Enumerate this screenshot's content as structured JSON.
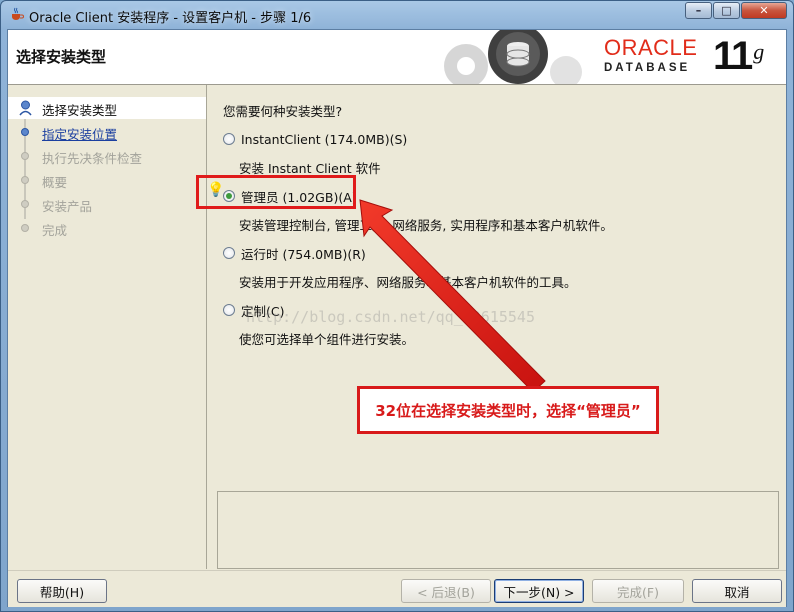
{
  "window": {
    "title": "Oracle Client 安装程序 - 设置客户机 - 步骤 1/6",
    "controls": {
      "minimize": "–",
      "maximize": "□",
      "close": "✕"
    }
  },
  "header": {
    "title": "选择安装类型",
    "brand_name": "ORACLE",
    "brand_sub": "DATABASE",
    "version": "11",
    "version_suffix": "g"
  },
  "steps": [
    {
      "label": "选择安装类型",
      "state": "active"
    },
    {
      "label": "指定安装位置",
      "state": "link"
    },
    {
      "label": "执行先决条件检查",
      "state": "disabled"
    },
    {
      "label": "概要",
      "state": "disabled"
    },
    {
      "label": "安装产品",
      "state": "disabled"
    },
    {
      "label": "完成",
      "state": "disabled"
    }
  ],
  "main": {
    "question": "您需要何种安装类型?",
    "options": [
      {
        "label": "InstantClient (174.0MB)(S)",
        "desc": "安装 Instant Client 软件",
        "selected": false
      },
      {
        "label": "管理员 (1.02GB)(A)",
        "desc": "安装管理控制台, 管理工具, 网络服务, 实用程序和基本客户机软件。",
        "selected": true
      },
      {
        "label": "运行时 (754.0MB)(R)",
        "desc": "安装用于开发应用程序、网络服务和基本客户机软件的工具。",
        "selected": false
      },
      {
        "label": "定制(C)",
        "desc": "使您可选择单个组件进行安装。",
        "selected": false
      }
    ]
  },
  "watermark": "http://blog.csdn.net/qq_39615545",
  "annotation": {
    "callout": "32位在选择安装类型时，选择“管理员”",
    "color": "#d81a1a"
  },
  "footer": {
    "help": "帮助(H)",
    "back": "< 后退(B)",
    "next": "下一步(N) >",
    "finish": "完成(F)",
    "cancel": "取消"
  },
  "icons": {
    "app": "java-cup-icon",
    "hint": "lightbulb-icon"
  }
}
